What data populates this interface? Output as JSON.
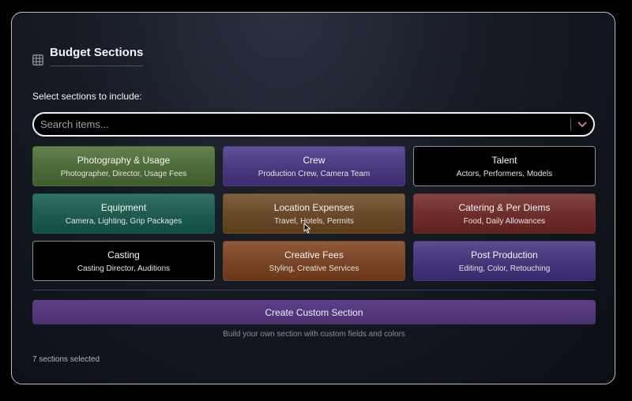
{
  "panel": {
    "title": "Budget Sections",
    "title_icon": "grid-icon",
    "prompt": "Select sections to include:"
  },
  "search": {
    "placeholder": "Search items...",
    "dropdown_icon": "chevron-down-icon",
    "accent": "#e27fb0"
  },
  "sections": [
    {
      "name": "Photography & Usage",
      "desc": "Photographer, Director, Usage Fees",
      "color": "#4e6b3a",
      "selected": true
    },
    {
      "name": "Crew",
      "desc": "Production Crew, Camera Team",
      "color": "#4b3a80",
      "selected": true
    },
    {
      "name": "Talent",
      "desc": "Actors, Performers, Models",
      "color": "#000000",
      "selected": false
    },
    {
      "name": "Equipment",
      "desc": "Camera, Lighting, Grip Packages",
      "color": "#1f5c50",
      "selected": true
    },
    {
      "name": "Location Expenses",
      "desc": "Travel, Hotels, Permits",
      "color": "#6b4a2a",
      "selected": true
    },
    {
      "name": "Catering & Per Diems",
      "desc": "Food, Daily Allowances",
      "color": "#6e2e2b",
      "selected": true
    },
    {
      "name": "Casting",
      "desc": "Casting Director, Auditions",
      "color": "#000000",
      "selected": false
    },
    {
      "name": "Creative Fees",
      "desc": "Styling, Creative Services",
      "color": "#7a4426",
      "selected": true
    },
    {
      "name": "Post Production",
      "desc": "Editing, Color, Retouching",
      "color": "#47367a",
      "selected": true
    }
  ],
  "custom": {
    "button_label": "Create Custom Section",
    "hint": "Build your own section with custom fields and colors"
  },
  "status": {
    "count_text": "7 sections selected"
  }
}
